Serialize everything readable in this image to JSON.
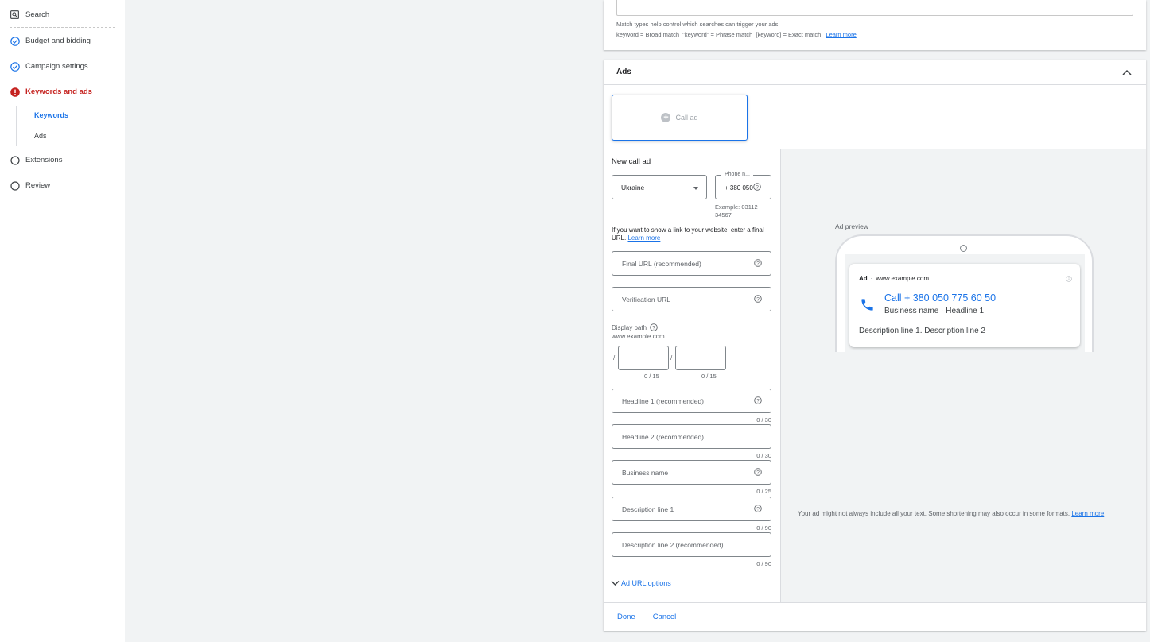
{
  "sidebar": {
    "items": [
      {
        "label": "Search",
        "icon": "search-icon"
      },
      {
        "label": "Budget and bidding",
        "icon": "check-circle-icon"
      },
      {
        "label": "Campaign settings",
        "icon": "check-circle-icon"
      },
      {
        "label": "Keywords and ads",
        "icon": "error-icon"
      },
      {
        "label": "Extensions",
        "icon": "empty-circle-icon"
      },
      {
        "label": "Review",
        "icon": "empty-circle-icon"
      }
    ],
    "sub_items": [
      {
        "label": "Keywords",
        "active": true
      },
      {
        "label": "Ads",
        "active": false
      }
    ]
  },
  "keywords": {
    "hint_line1": "Match types help control which searches can trigger your ads",
    "hint_line2": "keyword = Broad match  \"keyword\" = Phrase match  [keyword] = Exact match",
    "learn_more": "Learn more"
  },
  "ads": {
    "title": "Ads",
    "call_ad_button": "Call ad",
    "form": {
      "title": "New call ad",
      "country": "Ukraine",
      "phone_label": "Phone n...",
      "phone_value": "+ 380 050",
      "phone_example_line1": "Example: 03112",
      "phone_example_line2": "34567",
      "link_info": "If you want to show a link to your website, enter a final URL.",
      "link_learn_more": "Learn more",
      "final_url_placeholder": "Final URL (recommended)",
      "verification_url_placeholder": "Verification URL",
      "display_path_label": "Display path",
      "display_path_domain": "www.example.com",
      "path_separator": "/",
      "path1_counter": "0 / 15",
      "path2_counter": "0 / 15",
      "headline1_placeholder": "Headline 1 (recommended)",
      "headline1_counter": "0 / 30",
      "headline2_placeholder": "Headline 2 (recommended)",
      "headline2_counter": "0 / 30",
      "business_name_placeholder": "Business name",
      "business_name_counter": "0 / 25",
      "desc1_placeholder": "Description line 1",
      "desc1_counter": "0 / 90",
      "desc2_placeholder": "Description line 2 (recommended)",
      "desc2_counter": "0 / 90",
      "url_options": "Ad URL options"
    },
    "preview": {
      "label": "Ad preview",
      "ad_badge": "Ad",
      "dot": "·",
      "domain": "www.example.com",
      "call_text": "Call + 380 050 775 60 50",
      "subline": "Business name · Headline 1",
      "description": "Description line 1. Description line 2",
      "note": "Your ad might not always include all your text. Some shortening may also occur in some formats.",
      "note_link": "Learn more"
    },
    "footer": {
      "done": "Done",
      "cancel": "Cancel"
    }
  },
  "colors": {
    "accent": "#1a73e8",
    "error": "#c5221f",
    "background": "#f1f3f4"
  }
}
